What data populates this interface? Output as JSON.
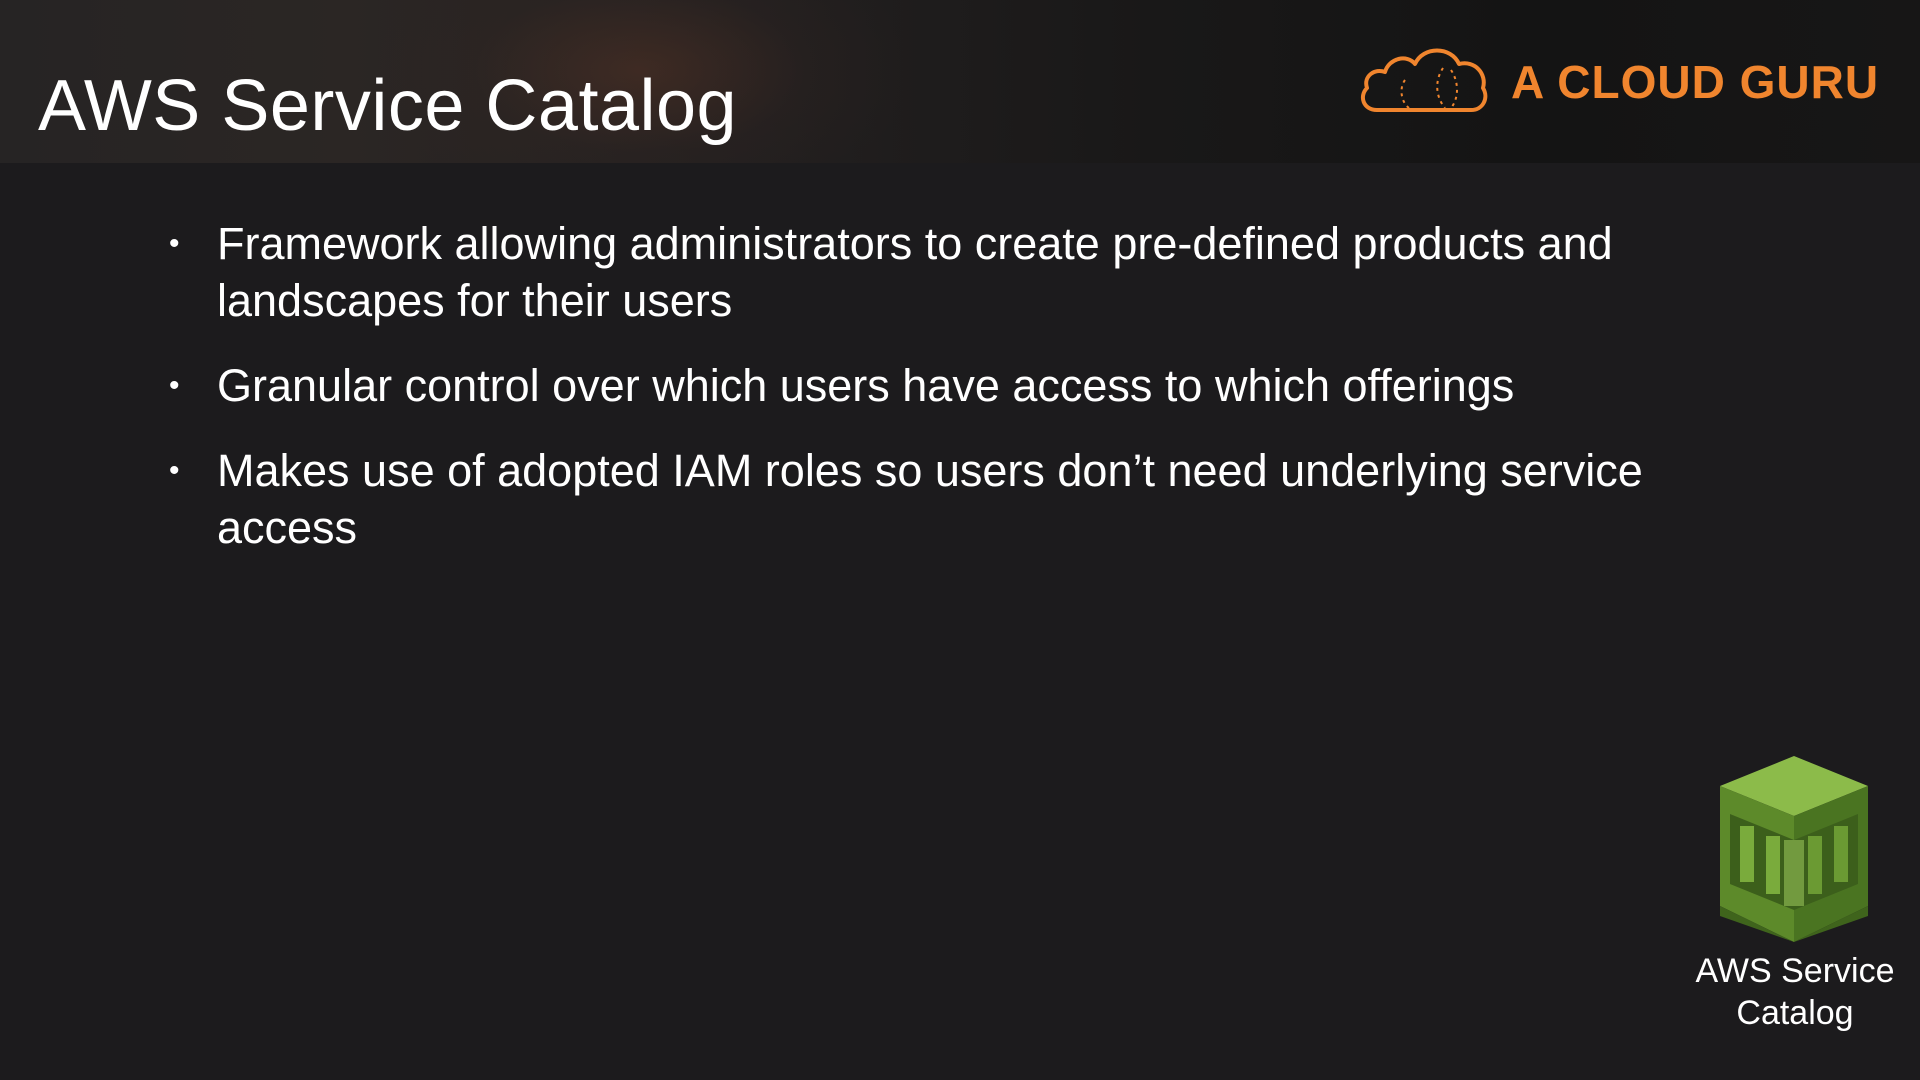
{
  "slide": {
    "title": "AWS Service Catalog",
    "brand": {
      "name": "A CLOUD GURU",
      "color": "#f0852e"
    },
    "bullets": [
      "Framework allowing administrators to create pre-defined products and landscapes for their users",
      "Granular control over which users have access to which offerings",
      "Makes use of adopted IAM roles so users don’t need underlying service access"
    ],
    "service_icon": {
      "icon": "aws-service-catalog-icon",
      "label_line1": "AWS Service",
      "label_line2": "Catalog",
      "color": "#6a9a2f"
    },
    "colors": {
      "background": "#1c1b1d",
      "header": "#1f1d1d",
      "text": "#ffffff"
    }
  }
}
